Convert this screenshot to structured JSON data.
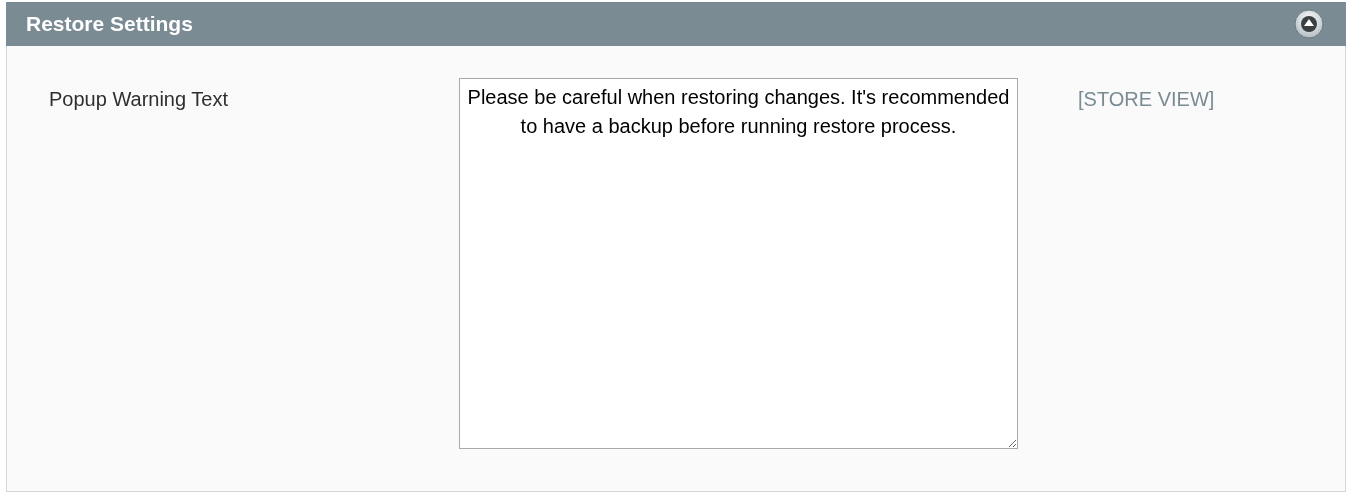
{
  "section": {
    "title": "Restore Settings",
    "expanded": true
  },
  "field": {
    "label": "Popup Warning Text",
    "value": "Please be careful when restoring changes. It's recommended to have a backup before running restore process.",
    "scope": "[STORE VIEW]"
  }
}
